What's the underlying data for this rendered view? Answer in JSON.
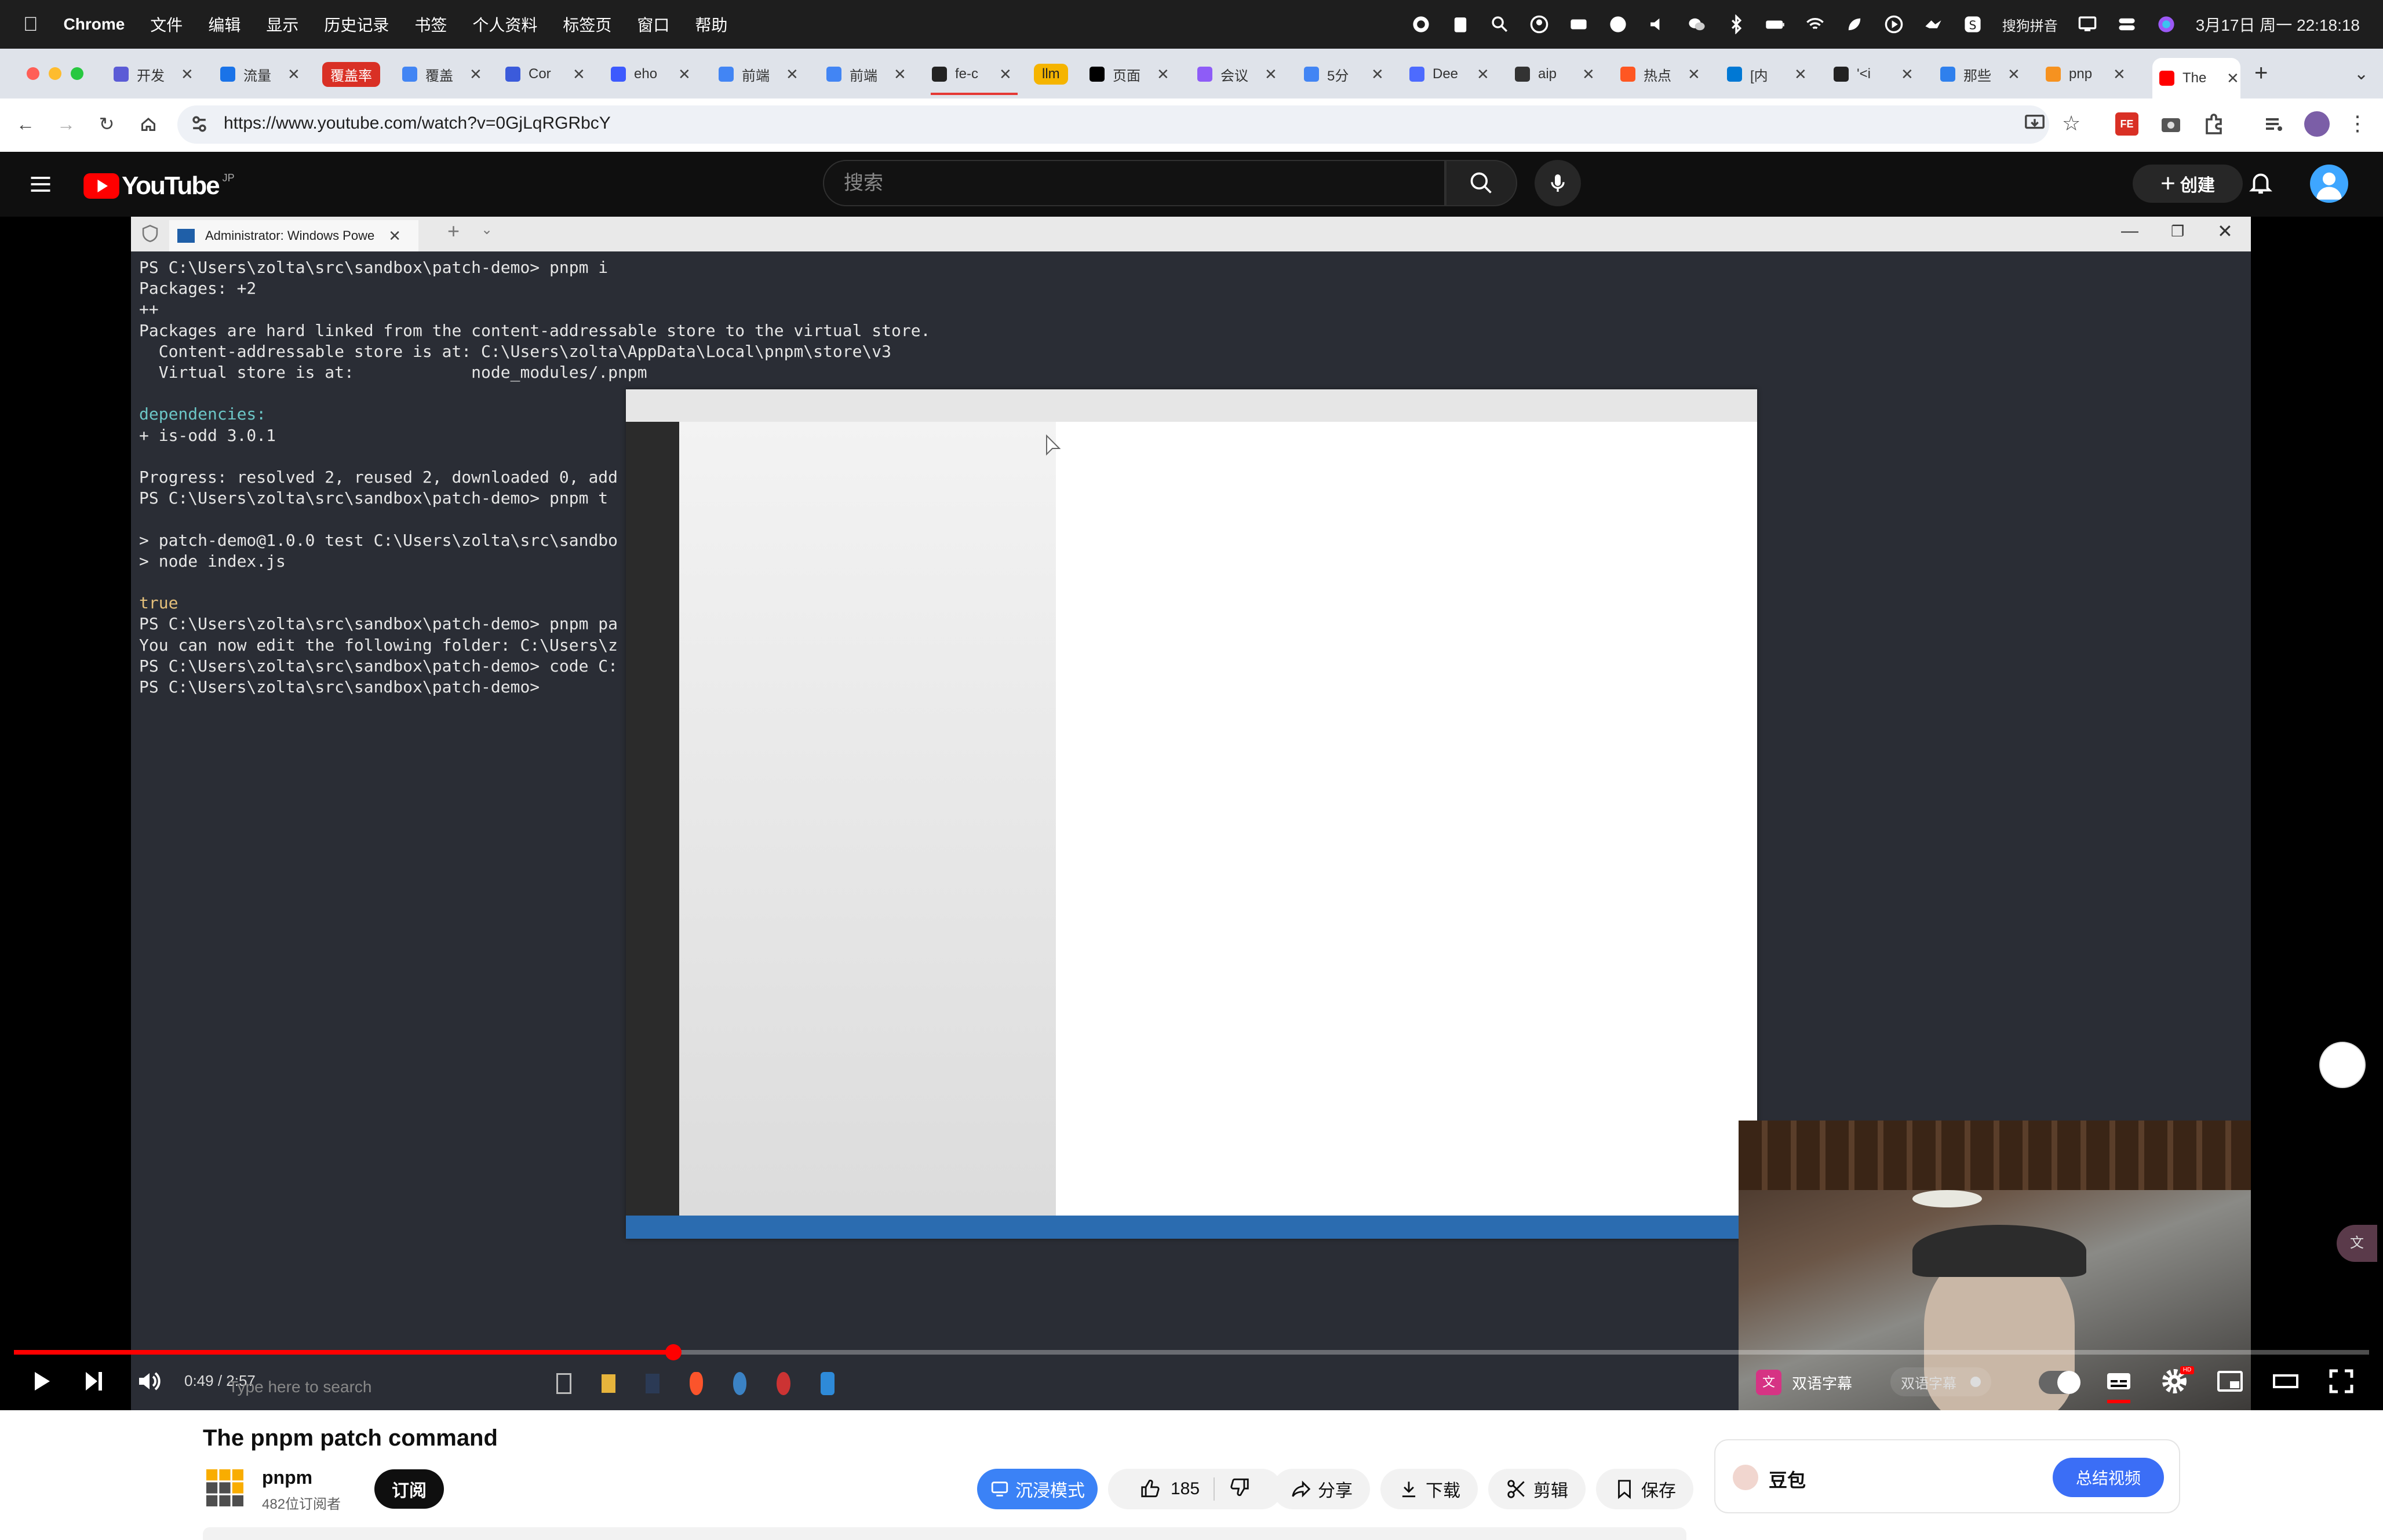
{
  "menubar": {
    "app": "Chrome",
    "items": [
      "文件",
      "编辑",
      "显示",
      "历史记录",
      "书签",
      "个人资料",
      "标签页",
      "窗口",
      "帮助"
    ],
    "ime": "搜狗拼音",
    "datetime": "3月17日 周一 22:18:18"
  },
  "tabs": [
    {
      "label": "开发",
      "color": "#5b5bd6"
    },
    {
      "label": "流量",
      "color": "#1a73e8"
    },
    {
      "label": "覆盖率",
      "color": "#d93025",
      "badge": true
    },
    {
      "label": "覆盖",
      "color": "#4285f4"
    },
    {
      "label": "Cor",
      "color": "#3b5bdb"
    },
    {
      "label": "eho",
      "color": "#3d5afe"
    },
    {
      "label": "前端",
      "color": "#4285f4"
    },
    {
      "label": "前端",
      "color": "#4285f4"
    },
    {
      "label": "fe-c",
      "color": "#222"
    },
    {
      "label": "llm",
      "color": "#f5b400",
      "badge": true
    },
    {
      "label": "页面",
      "color": "#000"
    },
    {
      "label": "会议",
      "color": "#8e5cf7"
    },
    {
      "label": "5分",
      "color": "#4285f4"
    },
    {
      "label": "Dee",
      "color": "#4d6bfe"
    },
    {
      "label": "aip",
      "color": "#333"
    },
    {
      "label": "热点",
      "color": "#ff5722"
    },
    {
      "label": "[内",
      "color": "#0078d4"
    },
    {
      "label": "'<i",
      "color": "#222"
    },
    {
      "label": "那些",
      "color": "#2f80ed"
    },
    {
      "label": "pnp",
      "color": "#f69220"
    },
    {
      "label": "The",
      "color": "#ff0000",
      "active": true
    }
  ],
  "address": {
    "url": "https://www.youtube.com/watch?v=0GjLqRGRbcY"
  },
  "youtube": {
    "logo": "YouTube",
    "region": "JP",
    "search_placeholder": "搜索",
    "create_label": "创建"
  },
  "terminal": {
    "tab_title": "Administrator: Windows Powe",
    "lines": [
      "PS C:\\Users\\zolta\\src\\sandbox\\patch-demo> pnpm i",
      "Packages: +2",
      "++",
      "Packages are hard linked from the content-addressable store to the virtual store.",
      "  Content-addressable store is at: C:\\Users\\zolta\\AppData\\Local\\pnpm\\store\\v3",
      "  Virtual store is at:            node_modules/.pnpm",
      "",
      "dependencies:",
      "+ is-odd 3.0.1",
      "",
      "Progress: resolved 2, reused 2, downloaded 0, add",
      "PS C:\\Users\\zolta\\src\\sandbox\\patch-demo> pnpm t",
      "",
      "> patch-demo@1.0.0 test C:\\Users\\zolta\\src\\sandbo",
      "> node index.js",
      "",
      "true",
      "PS C:\\Users\\zolta\\src\\sandbox\\patch-demo> pnpm pa",
      "You can now edit the following folder: C:\\Users\\z",
      "PS C:\\Users\\zolta\\src\\sandbox\\patch-demo> code C:",
      "PS C:\\Users\\zolta\\src\\sandbox\\patch-demo>"
    ]
  },
  "player": {
    "time": "0:49 / 2:57",
    "progress_fraction": 0.28,
    "taskbar_search": "Type here to search",
    "bilingual_label": "双语字幕",
    "bilingual_label2": "双语字幕"
  },
  "video": {
    "title": "The pnpm patch command",
    "channel": "pnpm",
    "subscribers": "482位订阅者",
    "subscribe_label": "订阅",
    "immersive_label": "沉浸模式",
    "likes": "185",
    "share_label": "分享",
    "download_label": "下载",
    "clip_label": "剪辑",
    "save_label": "保存"
  },
  "doubao": {
    "name": "豆包",
    "summarize_label": "总结视频"
  }
}
